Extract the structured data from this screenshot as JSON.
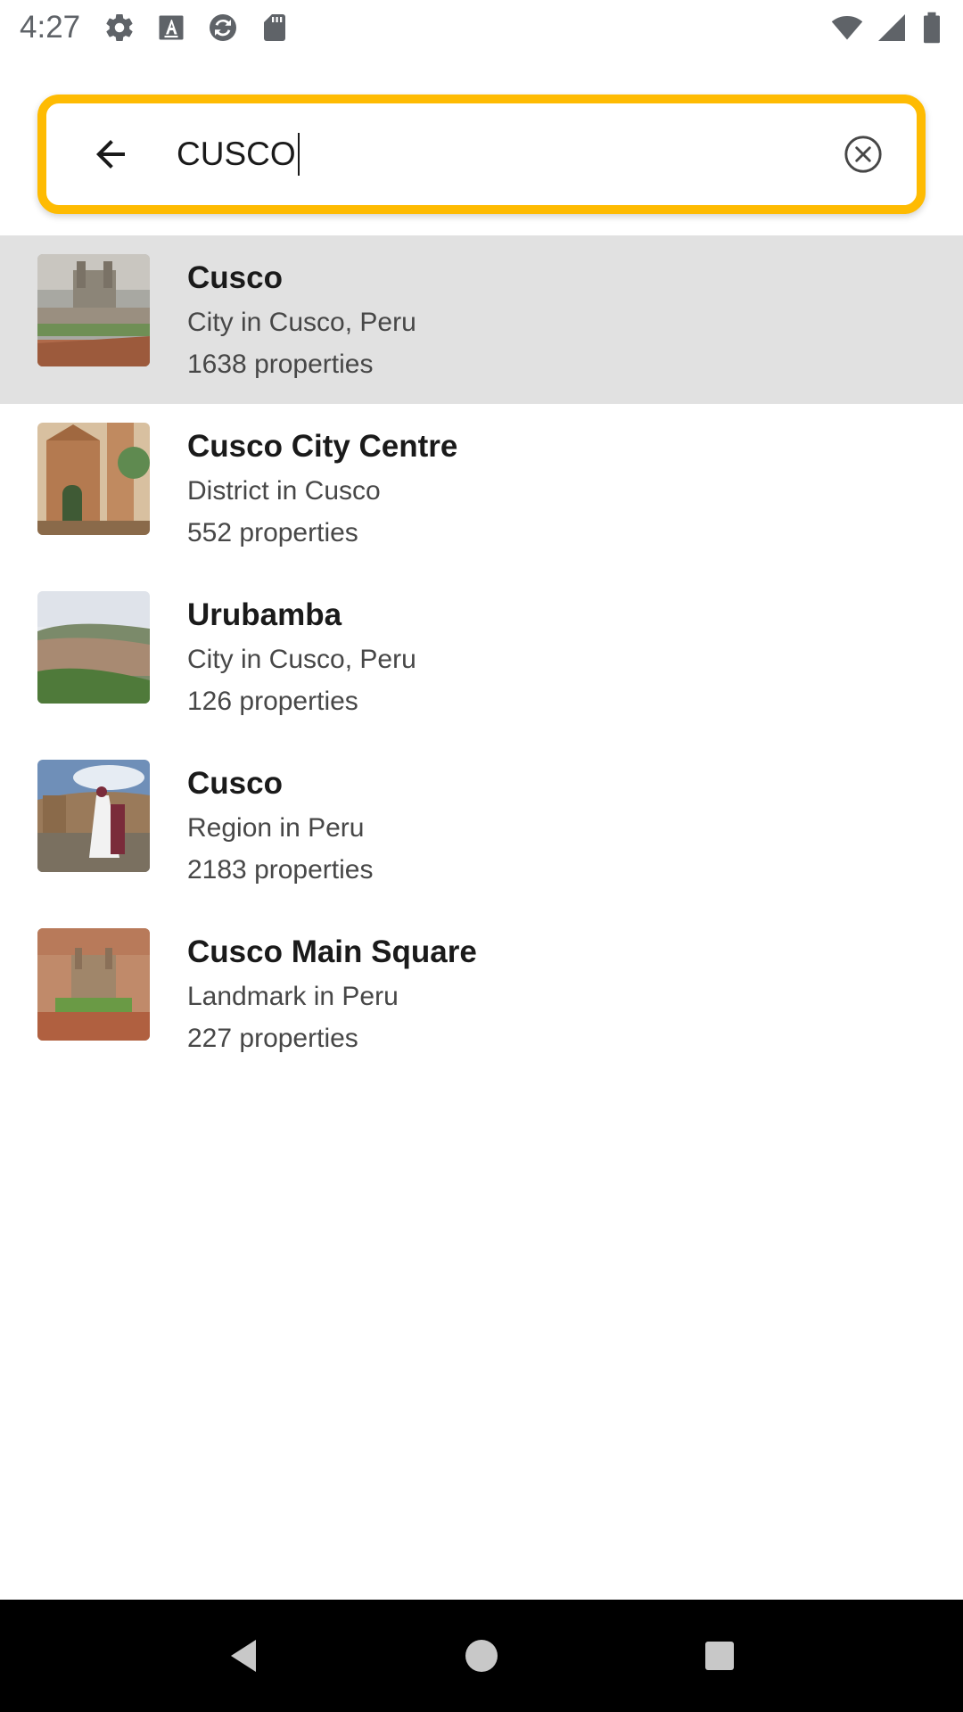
{
  "status_bar": {
    "time": "4:27",
    "left_icons": [
      "settings-icon",
      "text-a-icon",
      "sync-icon",
      "sd-card-icon"
    ],
    "right_icons": [
      "wifi-icon",
      "signal-icon",
      "battery-icon"
    ]
  },
  "search": {
    "value": "CUSCO",
    "back_icon": "arrow-left-icon",
    "clear_icon": "clear-circle-icon",
    "accent_color": "#febb02"
  },
  "results": [
    {
      "title": "Cusco",
      "subtitle": "City in Cusco, Peru",
      "count": "1638 properties",
      "selected": true
    },
    {
      "title": "Cusco City Centre",
      "subtitle": "District in Cusco",
      "count": "552 properties",
      "selected": false
    },
    {
      "title": "Urubamba",
      "subtitle": "City in Cusco, Peru",
      "count": "126 properties",
      "selected": false
    },
    {
      "title": "Cusco",
      "subtitle": "Region in Peru",
      "count": "2183 properties",
      "selected": false
    },
    {
      "title": "Cusco Main Square",
      "subtitle": "Landmark in Peru",
      "count": "227 properties",
      "selected": false
    }
  ],
  "nav_bar": {
    "icons": [
      "back-triangle-icon",
      "home-circle-icon",
      "recents-square-icon"
    ]
  }
}
